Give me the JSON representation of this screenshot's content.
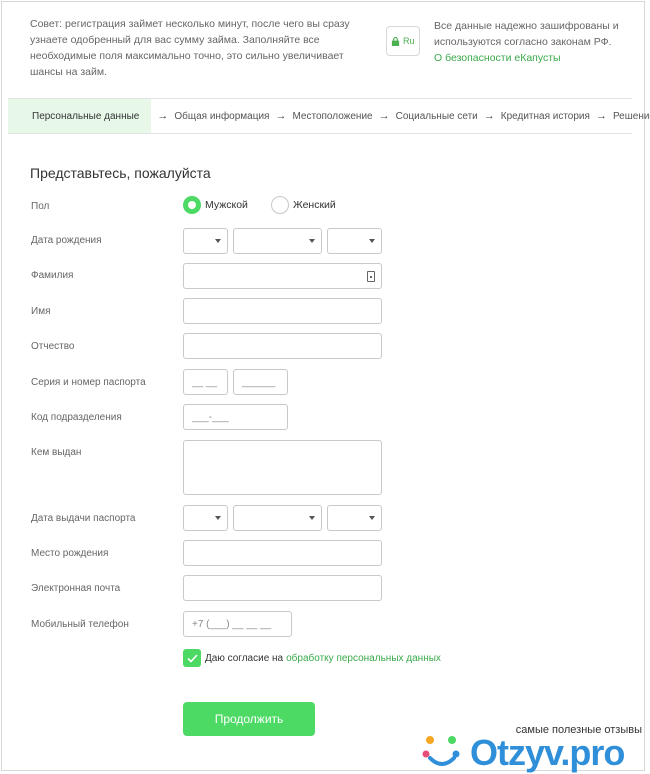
{
  "tip_text": "Совет: регистрация займет несколько минут, после чего вы сразу узнаете одобренный для вас сумму займа. Заполняйте все необходимые поля максимально точно, это сильно увеличивает шансы на займ.",
  "lock_badge_text": "Ru",
  "security": {
    "text": "Все данные надежно зашифрованы и используются согласно законам РФ.",
    "link": "О безопасности еКапусты"
  },
  "steps": [
    "Персональные данные",
    "Общая информация",
    "Местоположение",
    "Социальные сети",
    "Кредитная история",
    "Решение"
  ],
  "step_arrow": "→",
  "form": {
    "title": "Представьтесь, пожалуйста",
    "labels": {
      "gender": "Пол",
      "birth_date": "Дата рождения",
      "surname": "Фамилия",
      "name": "Имя",
      "patronymic": "Отчество",
      "passport_number": "Серия и номер паспорта",
      "division_code": "Код подразделения",
      "issued_by": "Кем выдан",
      "passport_date": "Дата выдачи паспорта",
      "birth_place": "Место рождения",
      "email": "Электронная почта",
      "phone": "Мобильный телефон"
    },
    "gender_options": [
      "Мужской",
      "Женский"
    ],
    "gender_selected": "Мужской",
    "placeholders": {
      "passport_series": "__ __",
      "passport_number": "______",
      "division_code": "___-___",
      "phone": "+7 (___) __ __ __"
    },
    "consent_text": "Даю согласие на",
    "consent_link": "обработку персональных данных",
    "consent_checked": true,
    "submit_label": "Продолжить"
  },
  "colors": {
    "accent": "#4cd964",
    "link": "#3aaa4a",
    "active_step_bg": "#e7f8e9"
  },
  "watermark": {
    "caption": "самые полезные отзывы",
    "brand": "Otzyv.pro"
  }
}
